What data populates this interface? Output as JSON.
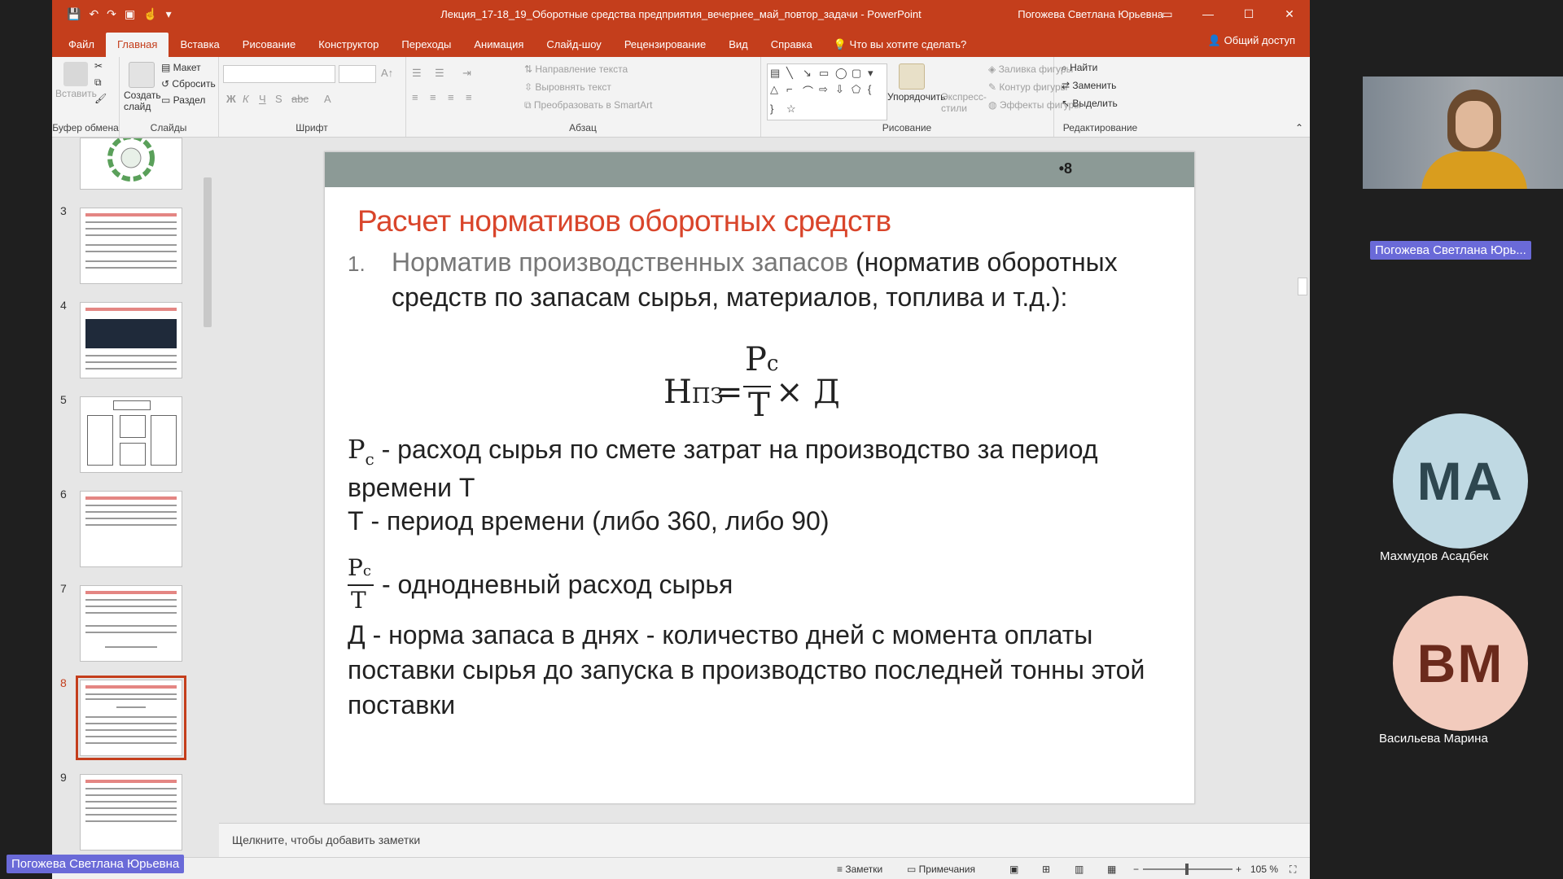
{
  "window": {
    "title": "Лекция_17-18_19_Оборотные средства предприятия_вечернее_май_повтор_задачи - PowerPoint",
    "user": "Погожева Светлана Юрьевна"
  },
  "ribbon_tabs": [
    "Файл",
    "Главная",
    "Вставка",
    "Рисование",
    "Конструктор",
    "Переходы",
    "Анимация",
    "Слайд-шоу",
    "Рецензирование",
    "Вид",
    "Справка"
  ],
  "tell_me": "Что вы хотите сделать?",
  "share": "Общий доступ",
  "ribbon": {
    "clipboard": {
      "paste": "Вставить",
      "label": "Буфер обмена"
    },
    "slides": {
      "new_slide": "Создать слайд",
      "layout": "Макет",
      "reset": "Сбросить",
      "section": "Раздел",
      "label": "Слайды"
    },
    "font": {
      "label": "Шрифт"
    },
    "paragraph": {
      "text_direction": "Направление текста",
      "align_text": "Выровнять текст",
      "smartart": "Преобразовать в SmartArt",
      "label": "Абзац"
    },
    "drawing": {
      "arrange": "Упорядочить",
      "quick_styles": "Экспресс-стили",
      "shape_fill": "Заливка фигуры",
      "shape_outline": "Контур фигуры",
      "shape_effects": "Эффекты фигуры",
      "label": "Рисование"
    },
    "editing": {
      "find": "Найти",
      "replace": "Заменить",
      "select": "Выделить",
      "label": "Редактирование"
    }
  },
  "thumbnails": [
    {
      "num": "3"
    },
    {
      "num": "4"
    },
    {
      "num": "5"
    },
    {
      "num": "6"
    },
    {
      "num": "7"
    },
    {
      "num": "8"
    },
    {
      "num": "9"
    }
  ],
  "slide": {
    "number": "•8",
    "title": "Расчет нормативов оборотных средств",
    "list_num": "1.",
    "p1_gray": "Норматив производственных запасов",
    "p1_rest": " (норматив оборотных средств по запасам сырья, материалов, топлива и т.д.):",
    "formula": {
      "lhs": "Н",
      "lhs_sub": "ПЗ",
      "eq": "=",
      "num": "Р",
      "num_sub": "с",
      "den": "Т",
      "times": "× Д"
    },
    "def1_sym": "Р",
    "def1_sub": "с",
    "def1_text": " - расход сырья по смете затрат на производство за период времени Т",
    "def2": "Т - период времени (либо 360, либо 90)",
    "def3_num": "Р",
    "def3_sub": "с",
    "def3_den": "Т",
    "def3_text": "- однодневный расход сырья",
    "def4": "Д - норма запаса в днях - количество дней с момента оплаты поставки сырья до запуска в производство последней тонны этой поставки"
  },
  "notes_placeholder": "Щелкните, чтобы добавить заметки",
  "status": {
    "notes": "Заметки",
    "comments": "Примечания",
    "zoom": "105 %"
  },
  "participants": {
    "presenter_tag": "Погожева Светлана Юрь...",
    "bottom_tag": "Погожева Светлана Юрьевна",
    "p1": {
      "initials": "МА",
      "name": "Махмудов Асадбек",
      "bg": "#bfd9e3",
      "fg": "#2e4750"
    },
    "p2": {
      "initials": "ВМ",
      "name": "Васильева Марина",
      "bg": "#f2cbbd",
      "fg": "#6b2a1c"
    }
  }
}
